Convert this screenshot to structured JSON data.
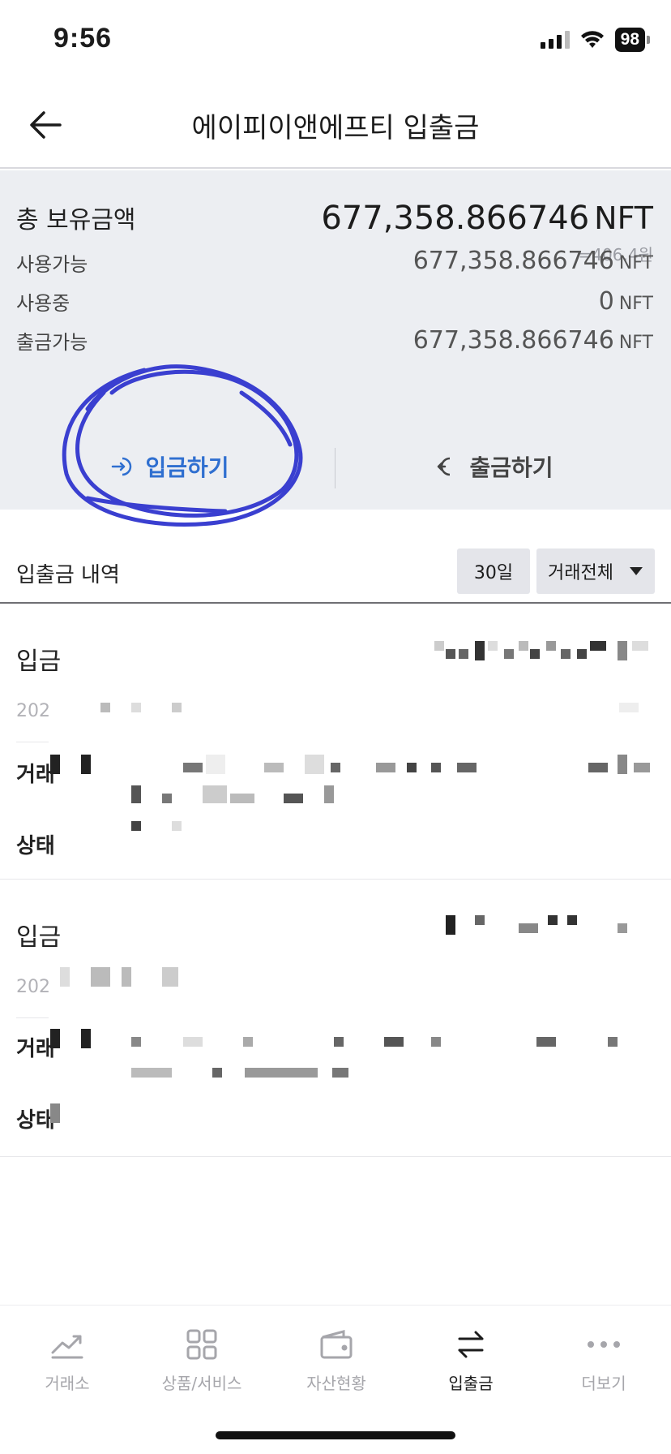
{
  "status_bar": {
    "time": "9:56",
    "battery": "98"
  },
  "header": {
    "title": "에이피이앤에프티 입출금"
  },
  "summary": {
    "total_label": "총 보유금액",
    "total_value": "677,358.866746",
    "unit": "NFT",
    "total_krw": "=406.4원",
    "rows": [
      {
        "label": "사용가능",
        "value": "677,358.866746",
        "unit": "NFT"
      },
      {
        "label": "사용중",
        "value": "0",
        "unit": "NFT"
      },
      {
        "label": "출금가능",
        "value": "677,358.866746",
        "unit": "NFT"
      }
    ],
    "deposit_label": "입금하기",
    "withdraw_label": "출금하기",
    "colors": {
      "deposit": "#2f6fd0",
      "annotation": "#3a3fd0",
      "panel_bg": "#eceef2"
    }
  },
  "history": {
    "title": "입출금 내역",
    "period": "30일",
    "filter": "거래전체",
    "items": [
      {
        "type": "입금",
        "date": "202",
        "sub1": "거래",
        "sub2": "상태"
      },
      {
        "type": "입금",
        "date": "202",
        "sub1": "거래",
        "sub2": "상태"
      }
    ]
  },
  "nav": {
    "items": [
      {
        "label": "거래소",
        "icon": "chart-trend-icon",
        "active": false
      },
      {
        "label": "상품/서비스",
        "icon": "grid-icon",
        "active": false
      },
      {
        "label": "자산현황",
        "icon": "wallet-icon",
        "active": false
      },
      {
        "label": "입출금",
        "icon": "transfer-arrows-icon",
        "active": true
      },
      {
        "label": "더보기",
        "icon": "more-dots-icon",
        "active": false
      }
    ]
  }
}
